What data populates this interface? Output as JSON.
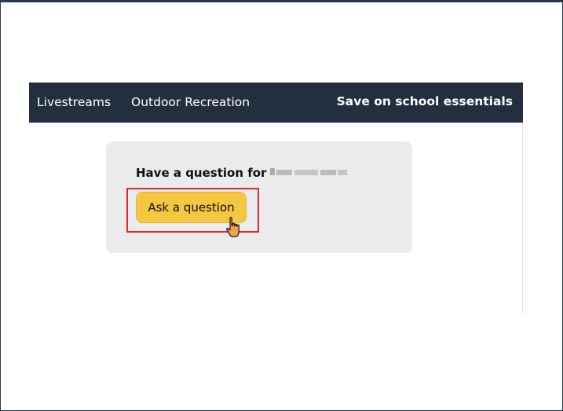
{
  "navbar": {
    "items": [
      {
        "label": "Livestreams"
      },
      {
        "label": "Outdoor Recreation"
      }
    ],
    "promo_label": "Save on school essentials"
  },
  "qa_card": {
    "heading": "Have a question for",
    "seller_name_redacted": true,
    "ask_button_label": "Ask a question"
  },
  "annotation": {
    "highlight_color": "#e8242d",
    "cursor_icon": "hand-pointer-icon",
    "cursor_color": "#f5a04a"
  },
  "colors": {
    "navbar_bg": "#232f3e",
    "card_bg": "#e9ebec",
    "button_bg": "#f5c640"
  }
}
